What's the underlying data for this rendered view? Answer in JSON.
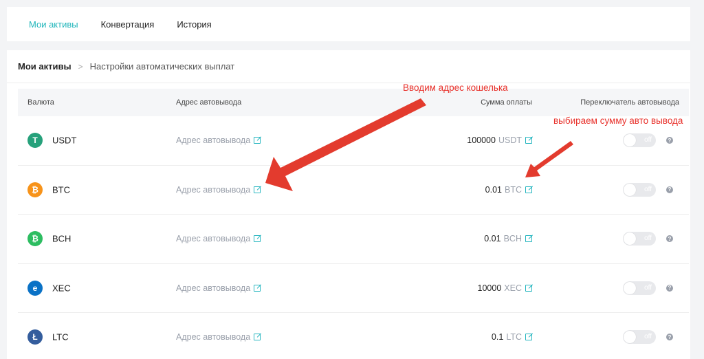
{
  "tabs": [
    {
      "label": "Мои активы",
      "active": true
    },
    {
      "label": "Конвертация",
      "active": false
    },
    {
      "label": "История",
      "active": false
    }
  ],
  "breadcrumb": {
    "root": "Мои активы",
    "separator": ">",
    "current": "Настройки автоматических выплат"
  },
  "table": {
    "headers": {
      "currency": "Валюта",
      "address": "Адрес автовывода",
      "amount": "Сумма оплаты",
      "toggle": "Переключатель автовывода"
    },
    "rows": [
      {
        "coin": "USDT",
        "icon_glyph": "T",
        "icon_color": "#26a17b",
        "address": "Адрес автовывода",
        "amount": "100000",
        "amount_currency": "USDT",
        "toggle_label": "off"
      },
      {
        "coin": "BTC",
        "icon_glyph": "₿",
        "icon_color": "#f7931a",
        "address": "Адрес автовывода",
        "amount": "0.01",
        "amount_currency": "BTC",
        "toggle_label": "off"
      },
      {
        "coin": "BCH",
        "icon_glyph": "₿",
        "icon_color": "#2dbd61",
        "address": "Адрес автовывода",
        "amount": "0.01",
        "amount_currency": "BCH",
        "toggle_label": "off"
      },
      {
        "coin": "XEC",
        "icon_glyph": "e",
        "icon_color": "#0a72c6",
        "address": "Адрес автовывода",
        "amount": "10000",
        "amount_currency": "XEC",
        "toggle_label": "off"
      },
      {
        "coin": "LTC",
        "icon_glyph": "Ł",
        "icon_color": "#345d9d",
        "address": "Адрес автовывода",
        "amount": "0.1",
        "amount_currency": "LTC",
        "toggle_label": "off"
      }
    ],
    "help_glyph": "?"
  },
  "annotations": {
    "address_note": "Вводим адрес кошелька",
    "amount_note": "выбираем сумму авто вывода"
  },
  "colors": {
    "accent": "#1fb5ba",
    "annotation": "#e8302a"
  }
}
